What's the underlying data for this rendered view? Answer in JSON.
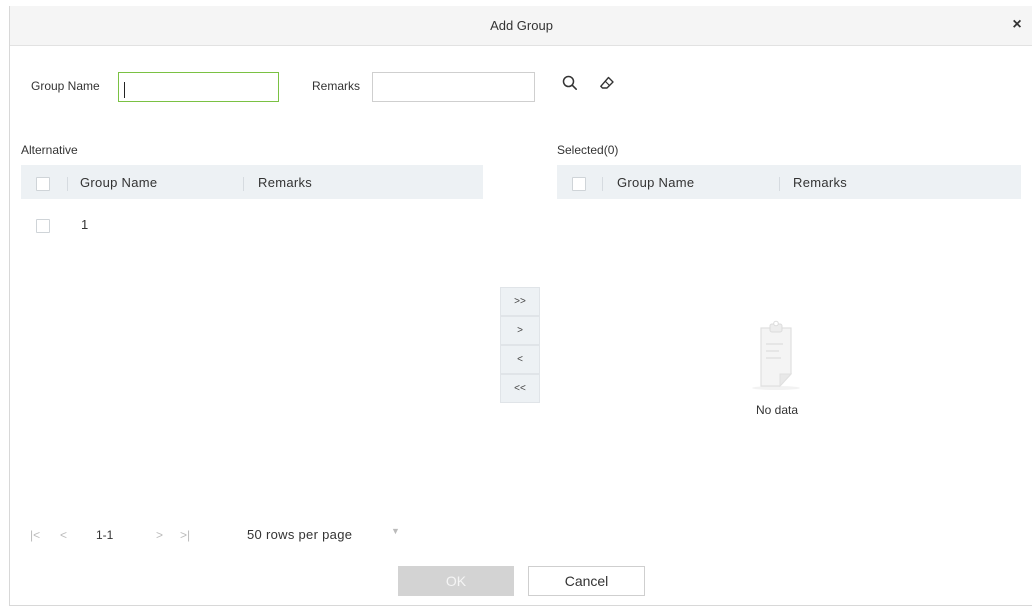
{
  "dialog": {
    "title": "Add Group",
    "close_glyph": "×"
  },
  "filters": {
    "group_name_label": "Group Name",
    "group_name_value": "",
    "remarks_label": "Remarks",
    "remarks_value": ""
  },
  "icons": {
    "search": "search-icon",
    "clear": "eraser-icon",
    "empty": "clipboard-icon"
  },
  "alternative": {
    "title": "Alternative",
    "columns": [
      "Group Name",
      "Remarks"
    ],
    "rows": [
      {
        "group_name": "1",
        "remarks": ""
      }
    ]
  },
  "selected": {
    "title": "Selected(0)",
    "columns": [
      "Group Name",
      "Remarks"
    ],
    "empty_text": "No data"
  },
  "transfer": {
    "move_all_right": ">>",
    "move_right": ">",
    "move_left": "<",
    "move_all_left": "<<"
  },
  "pagination": {
    "first": "|<",
    "prev": "<",
    "range": "1-1",
    "next": ">",
    "last": ">|",
    "rows_per_page": "50 rows per page",
    "caret": "▼"
  },
  "actions": {
    "ok": "OK",
    "cancel": "Cancel"
  }
}
